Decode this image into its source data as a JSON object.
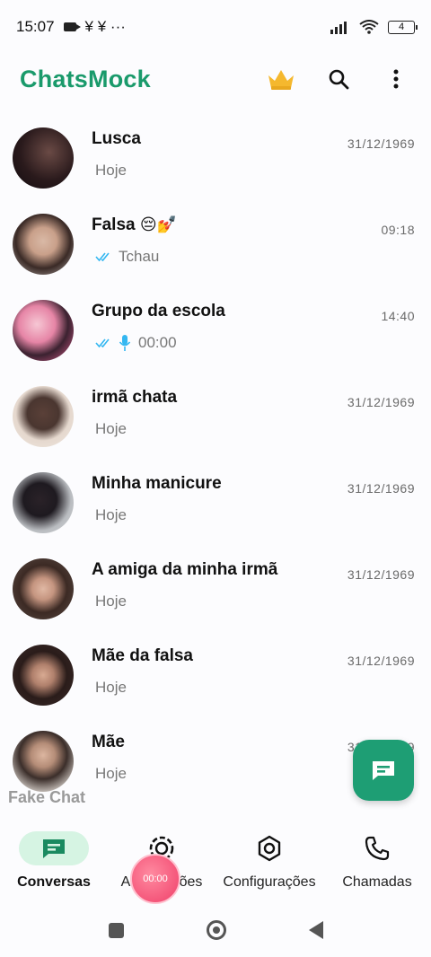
{
  "status_bar": {
    "time": "15:07",
    "extra": "¥  ¥  ···",
    "battery": "4"
  },
  "app": {
    "title": "ChatsMock"
  },
  "chats": [
    {
      "name": "Lusca",
      "time": "31/12/1969",
      "preview": "Hoje",
      "ticks": false,
      "mic": false,
      "emoji": ""
    },
    {
      "name": "Falsa",
      "time": "09:18",
      "preview": "Tchau",
      "ticks": true,
      "mic": false,
      "emoji": "😔💅"
    },
    {
      "name": "Grupo da escola",
      "time": "14:40",
      "preview": "00:00",
      "ticks": true,
      "mic": true,
      "emoji": ""
    },
    {
      "name": "irmã chata",
      "time": "31/12/1969",
      "preview": "Hoje",
      "ticks": false,
      "mic": false,
      "emoji": ""
    },
    {
      "name": "Minha manicure",
      "time": "31/12/1969",
      "preview": "Hoje",
      "ticks": false,
      "mic": false,
      "emoji": ""
    },
    {
      "name": "A amiga da minha irmã",
      "time": "31/12/1969",
      "preview": "Hoje",
      "ticks": false,
      "mic": false,
      "emoji": ""
    },
    {
      "name": "Mãe da falsa",
      "time": "31/12/1969",
      "preview": "Hoje",
      "ticks": false,
      "mic": false,
      "emoji": ""
    },
    {
      "name": "Mãe",
      "time": "31/12/1969",
      "preview": "Hoje",
      "ticks": false,
      "mic": false,
      "emoji": ""
    }
  ],
  "watermark": "Fake Chat",
  "nav": {
    "conversas": "Conversas",
    "atualizacoes": "Atualizações",
    "configuracoes": "Configurações",
    "chamadas": "Chamadas"
  },
  "rec_bubble": "00:00",
  "colors": {
    "brand": "#1a9a6b",
    "fab": "#1e9e74",
    "active_nav_bg": "#d6f4e3",
    "tick_blue": "#34b7f1",
    "crown": "#f5b82e"
  }
}
